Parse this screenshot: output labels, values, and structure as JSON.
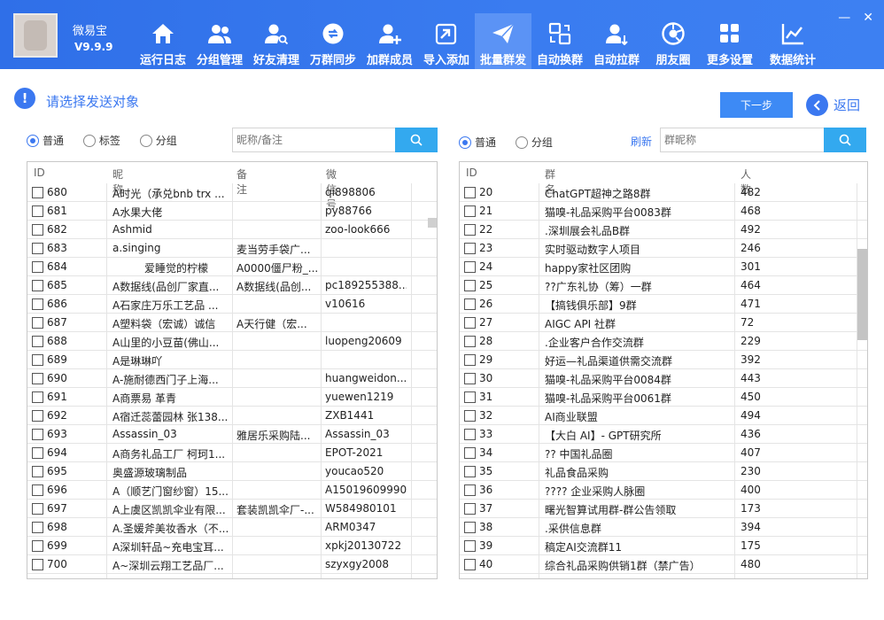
{
  "app": {
    "name": "微易宝",
    "version": "V9.9.9"
  },
  "nav": [
    {
      "label": "运行日志",
      "icon": "home-icon"
    },
    {
      "label": "分组管理",
      "icon": "users-icon"
    },
    {
      "label": "好友清理",
      "icon": "user-search-icon"
    },
    {
      "label": "万群同步",
      "icon": "sync-icon"
    },
    {
      "label": "加群成员",
      "icon": "user-add-icon"
    },
    {
      "label": "导入添加",
      "icon": "import-icon"
    },
    {
      "label": "批量群发",
      "icon": "send-icon",
      "active": true
    },
    {
      "label": "自动换群",
      "icon": "switch-icon"
    },
    {
      "label": "自动拉群",
      "icon": "user-pull-icon"
    },
    {
      "label": "朋友圈",
      "icon": "camera-icon"
    },
    {
      "label": "更多设置",
      "icon": "grid-icon"
    },
    {
      "label": "数据统计",
      "icon": "chart-icon"
    }
  ],
  "tip": {
    "text": "请选择发送对象"
  },
  "buttons": {
    "next": "下一步",
    "back": "返回",
    "refresh": "刷新"
  },
  "left": {
    "radios": [
      "普通",
      "标签",
      "分组"
    ],
    "selected": "普通",
    "search_placeholder": "昵称/备注",
    "columns": [
      "ID",
      "昵称",
      "备注",
      "微信号"
    ],
    "rows": [
      [
        "680",
        "A时光（承兑bnb trx ...",
        "",
        "qi898806"
      ],
      [
        "681",
        "A水果大佬",
        "",
        "py88766"
      ],
      [
        "682",
        "Ashmid",
        "",
        "zoo-look666"
      ],
      [
        "683",
        "a.singing",
        "麦当劳手袋广...",
        ""
      ],
      [
        "684",
        "　　　爱睡觉的柠檬",
        "A0000僵尸粉_...",
        ""
      ],
      [
        "685",
        "A数据线(品创厂家直...",
        "A数据线(品创...",
        "pc189255388..."
      ],
      [
        "686",
        "A石家庄万乐工艺品 ...",
        "",
        "v10616"
      ],
      [
        "687",
        "A塑料袋（宏诚）诚信",
        "A天行健（宏...",
        ""
      ],
      [
        "688",
        "A山里的小豆苗(佛山...",
        "",
        "luopeng20609"
      ],
      [
        "689",
        "A是琳琳吖",
        "",
        ""
      ],
      [
        "690",
        "A-施耐德西门子上海...",
        "",
        "huangweidon..."
      ],
      [
        "691",
        "A商票易 革青",
        "",
        "yuewen1219"
      ],
      [
        "692",
        "A宿迁蕊蕾园林 张138...",
        "",
        "ZXB1441"
      ],
      [
        "693",
        "Assassin_03",
        "雅居乐采购陆...",
        "Assassin_03"
      ],
      [
        "694",
        "A商务礼品工厂 柯珂1...",
        "",
        "EPOT-2021"
      ],
      [
        "695",
        "奥盛源玻璃制品",
        "",
        "youcao520"
      ],
      [
        "696",
        "A（顺艺门窗纱窗）15...",
        "",
        "A15019609990"
      ],
      [
        "697",
        "A上虞区凯凯伞业有限...",
        "套装凯凯伞厂-...",
        "W584980101"
      ],
      [
        "698",
        "A.圣媛斧美妆香水（不...",
        "",
        "ARM0347"
      ],
      [
        "699",
        "A深圳轩品~充电宝耳...",
        "",
        "xpkj20130722"
      ],
      [
        "700",
        "A~深圳云翔工艺品厂...",
        "",
        "szyxgy2008"
      ]
    ]
  },
  "right": {
    "radios": [
      "普通",
      "分组"
    ],
    "selected": "普通",
    "search_placeholder": "群昵称",
    "columns": [
      "ID",
      "群名",
      "人数"
    ],
    "rows": [
      [
        "20",
        "ChatGPT超神之路8群",
        "482"
      ],
      [
        "21",
        "猫嗅-礼品采购平台0083群",
        "468"
      ],
      [
        "22",
        ".深圳展会礼品B群",
        "492"
      ],
      [
        "23",
        "实时驱动数字人项目",
        "246"
      ],
      [
        "24",
        "happy家社区团购",
        "301"
      ],
      [
        "25",
        "??广东礼协（筹）一群",
        "464"
      ],
      [
        "26",
        "【搞钱俱乐部】9群",
        "471"
      ],
      [
        "27",
        "AIGC API 社群",
        "72"
      ],
      [
        "28",
        ".企业客户合作交流群",
        "229"
      ],
      [
        "29",
        "好运—礼品渠道供需交流群",
        "392"
      ],
      [
        "30",
        "猫嗅-礼品采购平台0084群",
        "443"
      ],
      [
        "31",
        "猫嗅-礼品采购平台0061群",
        "450"
      ],
      [
        "32",
        "AI商业联盟",
        "494"
      ],
      [
        "33",
        "【大白 AI】- GPT研究所",
        "436"
      ],
      [
        "34",
        "?? 中国礼品圈",
        "407"
      ],
      [
        "35",
        "礼品食品采购",
        "230"
      ],
      [
        "36",
        "???? 企业采购人脉圈",
        "400"
      ],
      [
        "37",
        "曙光智算试用群-群公告领取",
        "173"
      ],
      [
        "38",
        ".采供信息群",
        "394"
      ],
      [
        "39",
        "稿定AI交流群11",
        "175"
      ],
      [
        "40",
        "综合礼品采购供销1群（禁广告）",
        "480"
      ]
    ]
  },
  "colors": {
    "topbar": "#3a7cf0",
    "accent": "#3b78f0",
    "search_button": "#33a9ef"
  }
}
